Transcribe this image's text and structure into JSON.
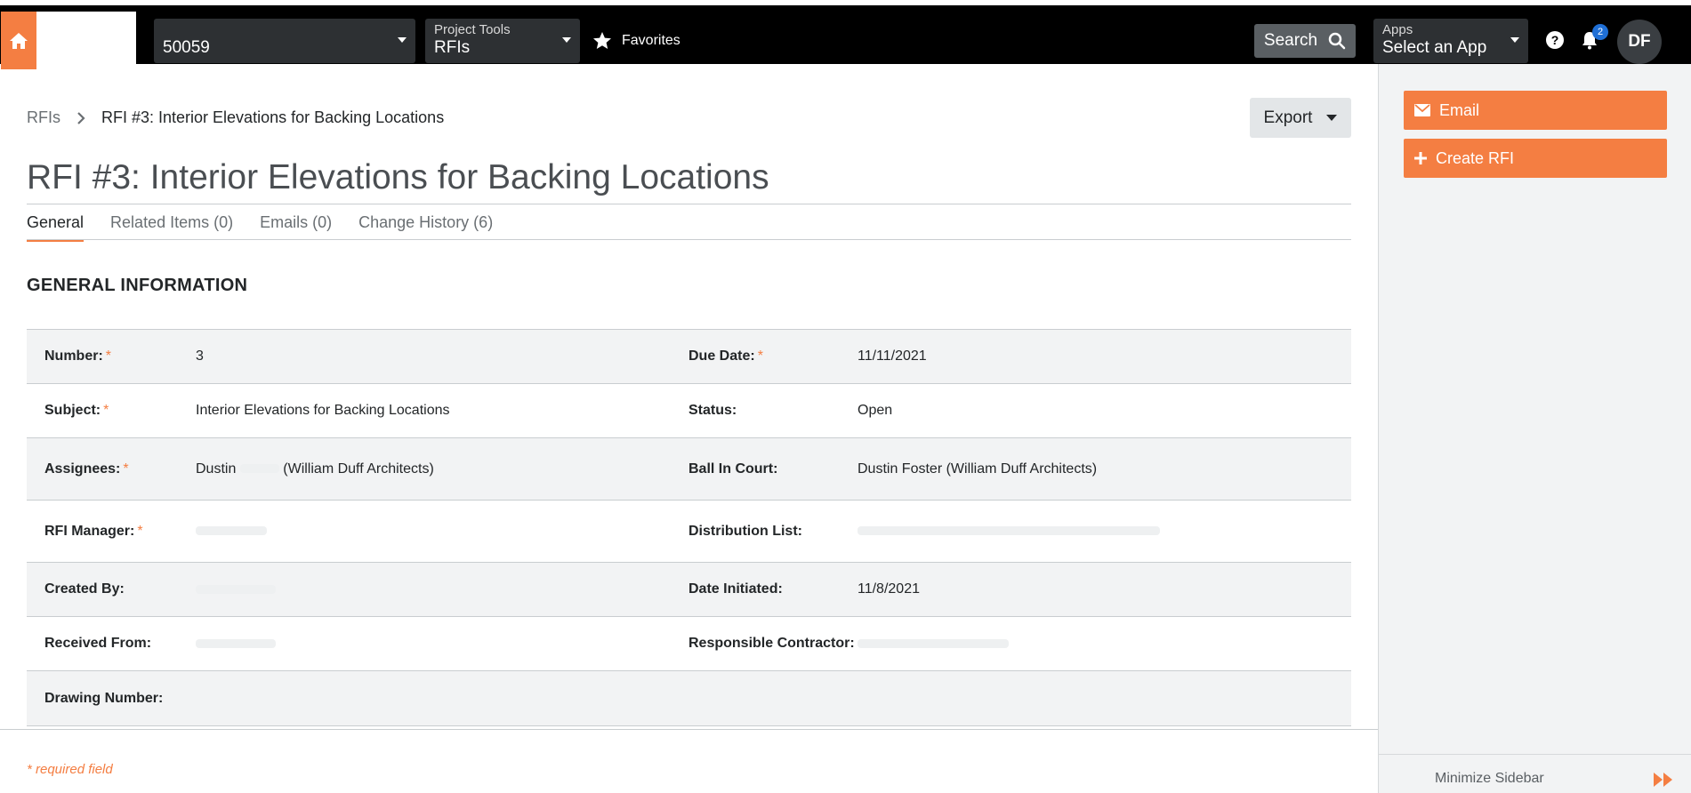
{
  "header": {
    "project": {
      "label": "",
      "value": "50059"
    },
    "tools": {
      "label": "Project Tools",
      "value": "RFIs"
    },
    "favorites_label": "Favorites",
    "search_label": "Search",
    "apps": {
      "label": "Apps",
      "value": "Select an App"
    },
    "help_glyph": "?",
    "notification_count": "2",
    "avatar_initials": "DF"
  },
  "breadcrumb": {
    "root": "RFIs",
    "current": "RFI #3: Interior Elevations for Backing Locations"
  },
  "export_label": "Export",
  "page_title": "RFI #3: Interior Elevations for Backing Locations",
  "tabs": [
    {
      "label": "General",
      "active": true
    },
    {
      "label": "Related Items (0)",
      "active": false
    },
    {
      "label": "Emails (0)",
      "active": false
    },
    {
      "label": "Change History (6)",
      "active": false
    }
  ],
  "section_title": "GENERAL INFORMATION",
  "required_mark": "*",
  "fields": {
    "number": {
      "label": "Number:",
      "value": "3"
    },
    "due_date": {
      "label": "Due Date:",
      "value": "11/11/2021"
    },
    "subject": {
      "label": "Subject:",
      "value": "Interior Elevations for Backing Locations"
    },
    "status": {
      "label": "Status:",
      "value": "Open"
    },
    "assignees": {
      "label": "Assignees:",
      "value_first": "Dustin",
      "value_company": "(William Duff Architects)"
    },
    "ball_in_court": {
      "label": "Ball In Court:",
      "value": "Dustin Foster (William Duff Architects)"
    },
    "rfi_manager": {
      "label": "RFI Manager:",
      "value": ""
    },
    "distribution_list": {
      "label": "Distribution List:",
      "value": ""
    },
    "created_by": {
      "label": "Created By:",
      "value": ""
    },
    "date_initiated": {
      "label": "Date Initiated:",
      "value": "11/8/2021"
    },
    "received_from": {
      "label": "Received From:",
      "value": ""
    },
    "responsible_contractor": {
      "label": "Responsible Contractor:",
      "value": ""
    },
    "drawing_number": {
      "label": "Drawing Number:",
      "value": ""
    }
  },
  "footer": {
    "required_note": "* required field"
  },
  "sidebar": {
    "email_label": "Email",
    "create_rfi_label": "Create RFI",
    "minimize_label": "Minimize Sidebar"
  },
  "colors": {
    "accent": "#f47e42",
    "topbar": "#000000",
    "badge": "#1f6fd6"
  }
}
